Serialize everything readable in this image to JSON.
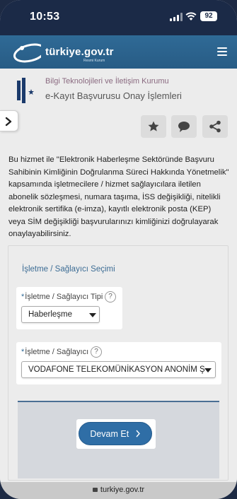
{
  "status_bar": {
    "time": "10:53",
    "battery": "92"
  },
  "header": {
    "site_name": "türkiye.gov.tr",
    "site_tagline": "Resmi Kurum"
  },
  "institution": {
    "name": "Bilgi Teknolojileri ve İletişim Kurumu",
    "page_title": "e-Kayıt Başvurusu Onay İşlemleri"
  },
  "intro_text": "Bu hizmet ile \"Elektronik Haberleşme Sektöründe Başvuru Sahibinin Kimliğinin Doğrulanma Süreci Hakkında Yönetmelik\" kapsamında işletmecilere / hizmet sağlayıcılara iletilen abonelik sözleşmesi, numara taşıma, İSS değişikliği, nitelikli elektronik sertifika (e-imza), kayıtlı elektronik posta (KEP) veya SİM değişikliği başvurularınızı kimliğinizi doğrulayarak onaylayabilirsiniz.",
  "form": {
    "section_title": "İşletme / Sağlayıcı Seçimi",
    "type_field": {
      "required_mark": "*",
      "label": "İşletme / Sağlayıcı Tipi",
      "help": "?",
      "value": "Haberleşme"
    },
    "provider_field": {
      "required_mark": "*",
      "label": "İşletme / Sağlayıcı",
      "help": "?",
      "value": "VODAFONE TELEKOMÜNİKASYON ANONİM Ş"
    },
    "submit_label": "Devam Et",
    "submit_icon": "chevron-right-icon"
  },
  "toolbar": {
    "icons": [
      "star-icon",
      "comment-icon",
      "share-icon"
    ]
  },
  "bottom_bar": {
    "url": "turkiye.gov.tr"
  },
  "colors": {
    "header": "#2f6a96",
    "status_bar": "#1b2a47",
    "accent": "#2f6ea6",
    "ministry_text": "#8a6a80"
  }
}
